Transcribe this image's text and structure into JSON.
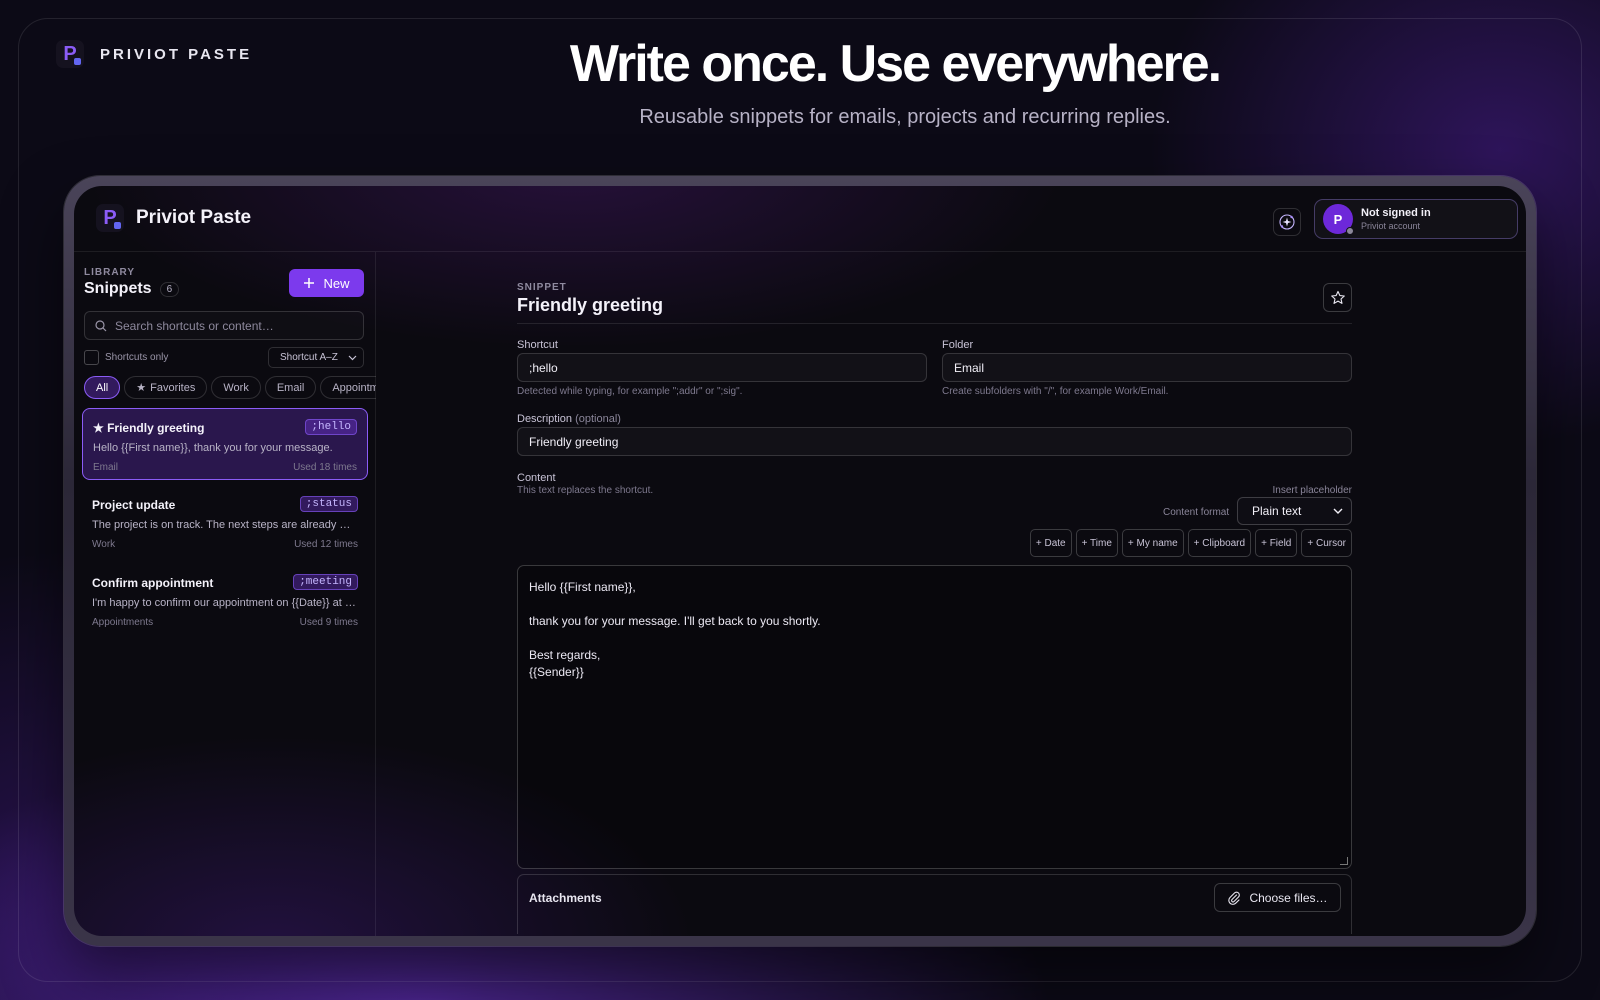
{
  "brand": {
    "name": "PRIVIOT PASTE"
  },
  "hero": {
    "title": "Write once. Use everywhere.",
    "subtitle": "Reusable snippets for emails, projects and recurring replies."
  },
  "app": {
    "title": "Priviot Paste",
    "account": {
      "initial": "P",
      "status": "Not signed in",
      "label": "Priviot account"
    }
  },
  "sidebar": {
    "section_label": "LIBRARY",
    "title": "Snippets",
    "count": "6",
    "new_label": "New",
    "search_placeholder": "Search shortcuts or content…",
    "shortcuts_only_label": "Shortcuts only",
    "sort_value": "Shortcut A–Z",
    "filters": [
      "All",
      "Favorites",
      "Work",
      "Email",
      "Appointments"
    ],
    "snippets": [
      {
        "title": "Friendly greeting",
        "favorite": true,
        "shortcut": ";hello",
        "preview": "Hello {{First name}}, thank you for your message.",
        "folder": "Email",
        "used": "Used 18 times"
      },
      {
        "title": "Project update",
        "favorite": false,
        "shortcut": ";status",
        "preview": "The project is on track. The next steps are already planned.",
        "folder": "Work",
        "used": "Used 12 times"
      },
      {
        "title": "Confirm appointment",
        "favorite": false,
        "shortcut": ";meeting",
        "preview": "I'm happy to confirm our appointment on {{Date}} at {{Time}}.",
        "folder": "Appointments",
        "used": "Used 9 times"
      }
    ]
  },
  "editor": {
    "section_label": "SNIPPET",
    "title": "Friendly greeting",
    "shortcut_label": "Shortcut",
    "shortcut_value": ";hello",
    "shortcut_hint": "Detected while typing, for example \";addr\" or \";sig\".",
    "folder_label": "Folder",
    "folder_value": "Email",
    "folder_hint": "Create subfolders with \"/\", for example Work/Email.",
    "description_label": "Description",
    "description_optional": "(optional)",
    "description_value": "Friendly greeting",
    "content_label": "Content",
    "content_hint": "This text replaces the shortcut.",
    "insert_placeholder_label": "Insert placeholder",
    "content_format_label": "Content format",
    "content_format_value": "Plain text",
    "placeholders": [
      "+ Date",
      "+ Time",
      "+ My name",
      "+ Clipboard",
      "+ Field",
      "+ Cursor"
    ],
    "content_lines": [
      "Hello {{First name}},",
      "",
      "thank you for your message. I'll get back to you shortly.",
      "",
      "Best regards,",
      "{{Sender}}"
    ],
    "attachments_label": "Attachments",
    "choose_files_label": "Choose files…"
  },
  "colors": {
    "accent": "#7c3aed",
    "accent_light": "#8b5cf6",
    "background": "#0b0a10"
  }
}
